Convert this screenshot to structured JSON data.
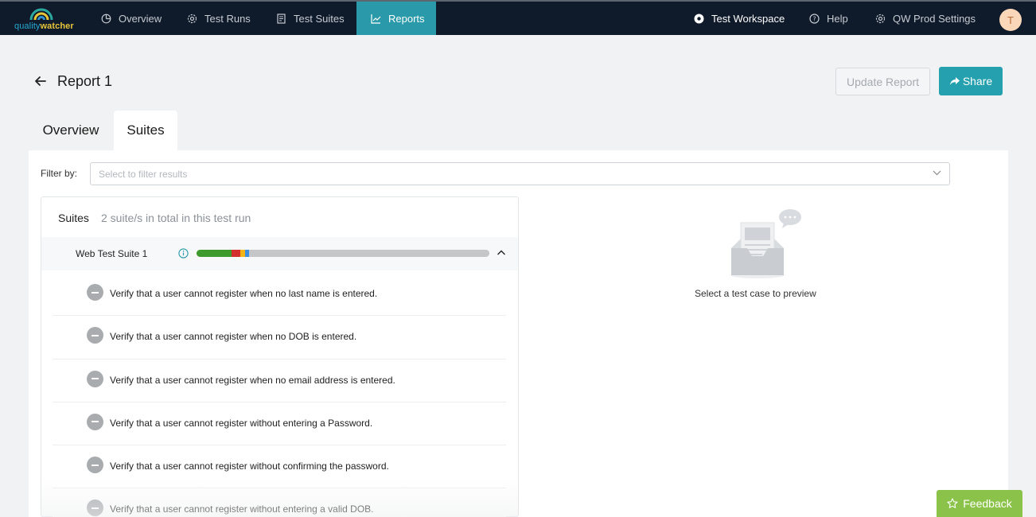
{
  "brand": {
    "name_part1": "quality",
    "name_part2": "watcher"
  },
  "nav": {
    "items": [
      {
        "label": "Overview",
        "icon": "chart-pie-icon"
      },
      {
        "label": "Test Runs",
        "icon": "gear-icon"
      },
      {
        "label": "Test Suites",
        "icon": "document-icon"
      },
      {
        "label": "Reports",
        "icon": "line-chart-icon",
        "active": true
      }
    ],
    "workspace": "Test Workspace",
    "help": "Help",
    "settings": "QW Prod Settings",
    "avatar_initial": "T"
  },
  "header": {
    "title": "Report 1",
    "update_button": "Update Report",
    "share_button": "Share"
  },
  "tabs": [
    {
      "label": "Overview",
      "active": false
    },
    {
      "label": "Suites",
      "active": true
    }
  ],
  "filter": {
    "label": "Filter by:",
    "placeholder": "Select to filter results"
  },
  "suites": {
    "title": "Suites",
    "count_text": "2 suite/s in total in this test run",
    "suite": {
      "name": "Web Test Suite 1",
      "progress_segments": [
        {
          "status": "passed",
          "fraction": 0.12,
          "color": "#3d9a2c"
        },
        {
          "status": "failed",
          "fraction": 0.03,
          "color": "#d32f2f"
        },
        {
          "status": "warning",
          "fraction": 0.015,
          "color": "#f2b416"
        },
        {
          "status": "info",
          "fraction": 0.015,
          "color": "#3b8ee0"
        },
        {
          "status": "not-run",
          "fraction": 0.82,
          "color": "#c4c6c8"
        }
      ],
      "cases": [
        "Verify that a user cannot register when no last name is entered.",
        "Verify that a user cannot register when no DOB is entered.",
        "Verify that a user cannot register when no email address is entered.",
        "Verify that a user cannot register without entering a Password.",
        "Verify that a user cannot register without confirming the password.",
        "Verify that a user cannot register without entering a valid DOB."
      ]
    }
  },
  "preview": {
    "empty_text": "Select a test case to preview"
  },
  "feedback": {
    "label": "Feedback"
  },
  "colors": {
    "nav_bg": "#0f1a2a",
    "accent": "#25a0ae",
    "feedback": "#8bc34a"
  }
}
